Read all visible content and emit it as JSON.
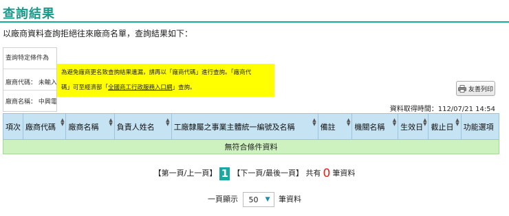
{
  "header": {
    "title": "查詢結果",
    "intro": "以廠商資料查詢拒絕往來廠商名單，查詢結果如下："
  },
  "conditions": {
    "title": "查詢特定條件為",
    "vendor_code": "廠商代碼： 未輸入",
    "vendor_name": "廠商名稱： 中興電"
  },
  "notice": {
    "line1": "為避免廠商更名致查詢結果遺漏，請再以「廠商代碼」進行查詢。「廠商代",
    "line2_prefix": "碼」可至經濟部「",
    "link_text": "全國商工行政服務入口網",
    "line2_suffix": "」查詢。",
    "bg_color": "#ffff00"
  },
  "toolbar": {
    "print_label": "友善列印"
  },
  "fetch_time": "資料取得時間：112/07/21 14:54",
  "table": {
    "columns": [
      "項次",
      "廠商代碼",
      "廠商名稱",
      "負責人姓名",
      "工廠隸屬之事業主體統一編號及名稱",
      "備註",
      "機關名稱",
      "生效日",
      "截止日",
      "功能選項"
    ],
    "empty_message": "無符合條件資料"
  },
  "pagination": {
    "first_prev": "【第一頁/上一頁】",
    "current_page": "1",
    "next_last": "【下一頁/最後一頁】",
    "total_prefix": "共有",
    "total_count": "0",
    "total_suffix": "筆資料"
  },
  "page_size": {
    "prefix": "一頁顯示",
    "value": "50",
    "suffix": "筆資料"
  }
}
